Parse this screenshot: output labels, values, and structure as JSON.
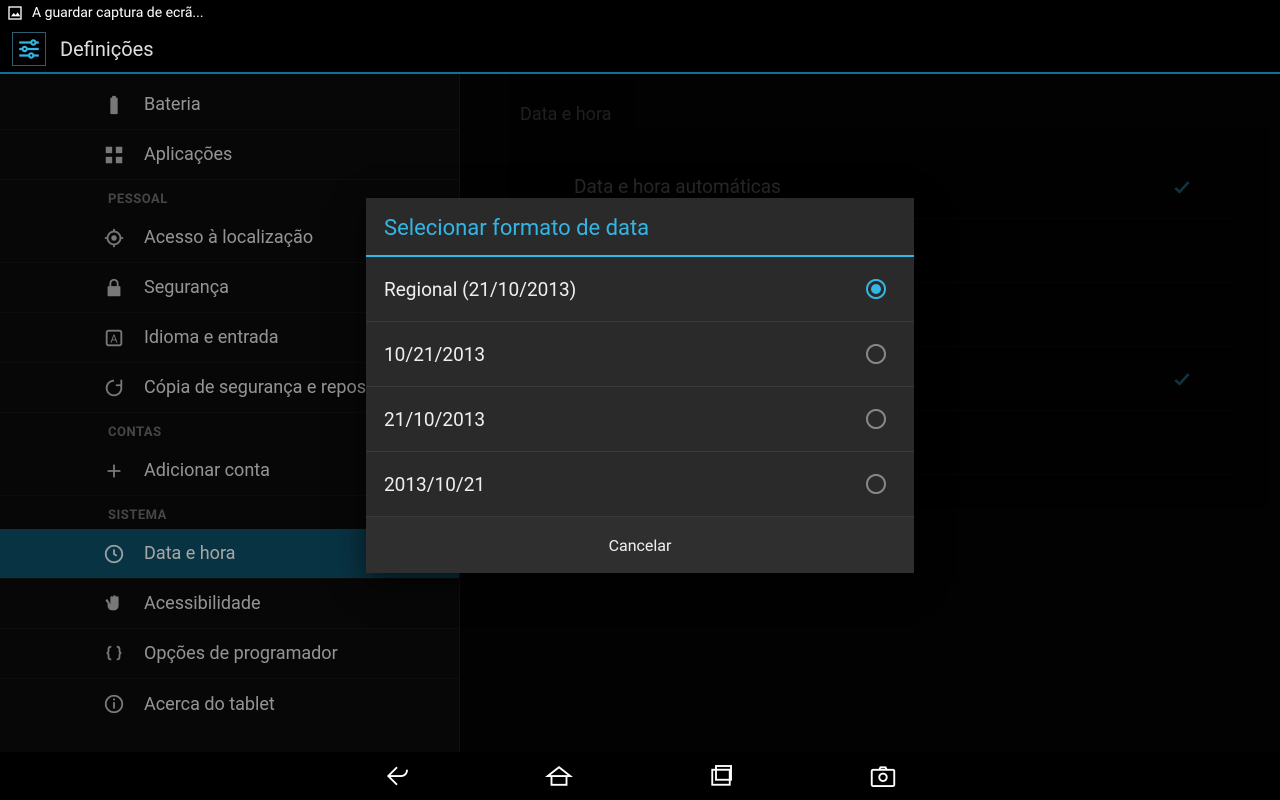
{
  "status_bar": {
    "text": "A guardar captura de ecrã..."
  },
  "action_bar": {
    "title": "Definições"
  },
  "sidebar": {
    "items": [
      {
        "label": "Bateria"
      },
      {
        "label": "Aplicações"
      }
    ],
    "pessoal_header": "PESSOAL",
    "pessoal": [
      {
        "label": "Acesso à localização"
      },
      {
        "label": "Segurança"
      },
      {
        "label": "Idioma e entrada"
      },
      {
        "label": "Cópia de segurança e reposição"
      }
    ],
    "contas_header": "CONTAS",
    "contas": [
      {
        "label": "Adicionar conta"
      }
    ],
    "sistema_header": "SISTEMA",
    "sistema": [
      {
        "label": "Data e hora"
      },
      {
        "label": "Acessibilidade"
      },
      {
        "label": "Opções de programador"
      },
      {
        "label": "Acerca do tablet"
      }
    ]
  },
  "detail": {
    "section_title": "Data e hora",
    "rows": [
      {
        "label": "Data e hora automáticas",
        "checked": true
      },
      {
        "label": "",
        "checked": false
      },
      {
        "label": "",
        "checked": false
      },
      {
        "label": "",
        "checked": true
      },
      {
        "label": "",
        "checked": false
      }
    ]
  },
  "dialog": {
    "title": "Selecionar formato de data",
    "options": [
      {
        "label": "Regional (21/10/2013)",
        "selected": true
      },
      {
        "label": "10/21/2013",
        "selected": false
      },
      {
        "label": "21/10/2013",
        "selected": false
      },
      {
        "label": "2013/10/21",
        "selected": false
      }
    ],
    "cancel": "Cancelar"
  },
  "colors": {
    "accent": "#33b5e5",
    "divider": "#0f6f9e"
  }
}
